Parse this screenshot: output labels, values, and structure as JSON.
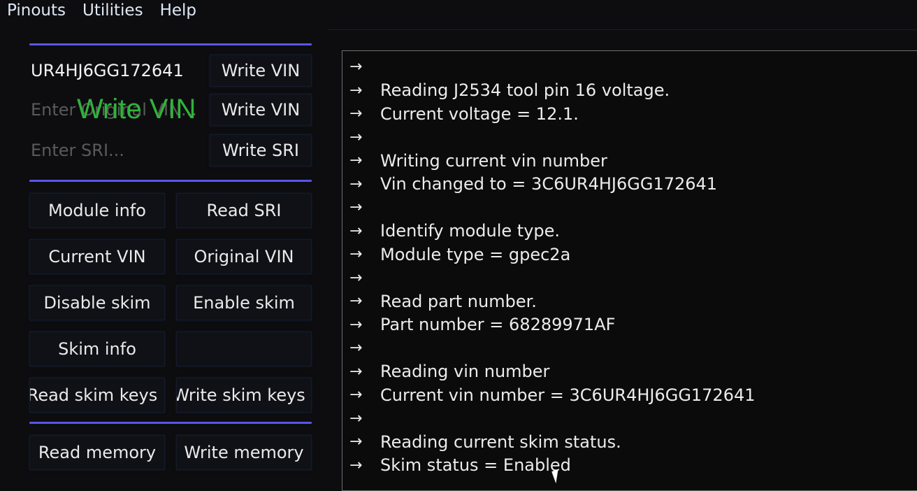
{
  "menu": [
    "Pinouts",
    "Utilities",
    "Help"
  ],
  "vin_section": {
    "current_vin_value": "UR4HJ6GG172641",
    "original_vin_placeholder": "Enter Original VIN...",
    "sri_placeholder": "Enter SRI...",
    "write_vin_label": "Write VIN",
    "write_original_vin_label": "Write VIN",
    "write_sri_label": "Write SRI"
  },
  "overlay_caption": "Write VIN",
  "buttons": [
    [
      "Module info",
      "Read SRI"
    ],
    [
      "Current VIN",
      "Original VIN"
    ],
    [
      "Disable skim",
      "Enable skim"
    ],
    [
      "Skim info",
      ""
    ],
    [
      "Read skim keys",
      "Write skim keys"
    ]
  ],
  "memory_buttons": [
    "Read memory",
    "Write memory"
  ],
  "console": {
    "arrow": "→",
    "lines": [
      "",
      "Reading J2534 tool pin 16 voltage.",
      "Current voltage = 12.1.",
      "",
      "Writing current vin number",
      "Vin changed to = 3C6UR4HJ6GG172641",
      "",
      "Identify module type.",
      "Module type = gpec2a",
      "",
      "Read part number.",
      "Part number = 68289971AF",
      "",
      "Reading vin number",
      "Current vin number = 3C6UR4HJ6GG172641",
      "",
      "Reading current skim status.",
      "Skim status = Enabled"
    ]
  },
  "colors": {
    "separator": "#5a55ee",
    "overlay": "#2fb43a",
    "background": "#0d0d0f"
  }
}
